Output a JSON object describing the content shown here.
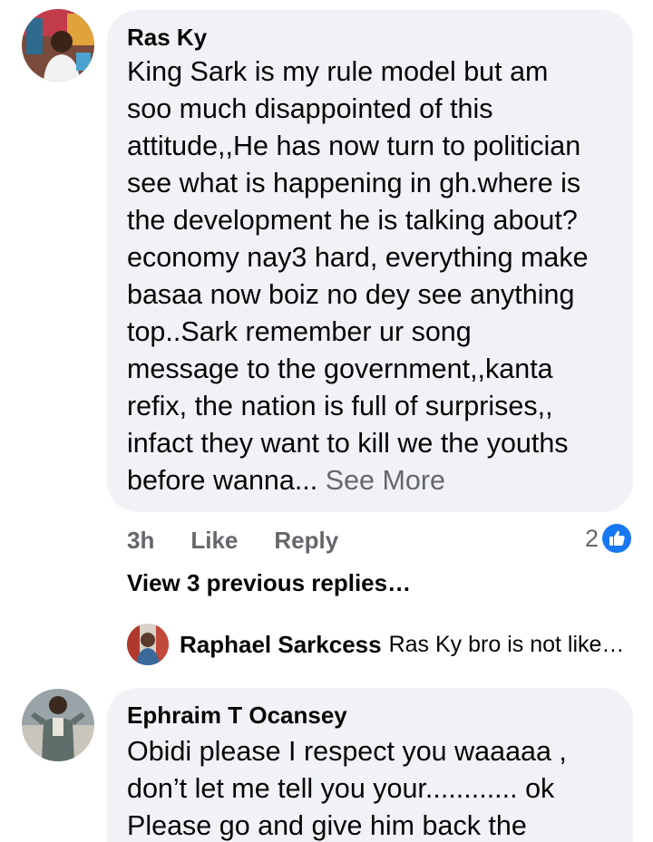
{
  "comments": [
    {
      "author": "Ras Ky",
      "lines": [
        "King Sark is my rule model but am",
        "soo much disappointed of this",
        "attitude,,He has now turn to politician",
        "see what is happening in gh.where is",
        "the development he is talking about?",
        "economy nay3 hard, everything make",
        "basaa now boiz no dey see anything",
        "top..Sark remember ur song",
        "message to the government,,kanta",
        "refix, the nation is full of surprises,,",
        "infact they want to kill we the youths",
        "before wanna..."
      ],
      "see_more": "See More",
      "time": "3h",
      "like_label": "Like",
      "reply_label": "Reply",
      "reaction_count": "2",
      "reaction_icon": "thumbs-up-icon",
      "reaction_color": "#1877f2",
      "view_previous": "View 3 previous replies…",
      "latest_reply": {
        "author": "Raphael Sarkcess",
        "text": "Ras Ky bro is not like…"
      }
    },
    {
      "author": "Ephraim T Ocansey",
      "lines": [
        "Obidi please I respect you waaaaa ,",
        "don’t let me tell you your............ ok",
        "Please go and give him back the"
      ]
    }
  ],
  "colors": {
    "bubble": "#f0f2f5",
    "secondary_text": "#65676b",
    "primary_text": "#050505"
  }
}
